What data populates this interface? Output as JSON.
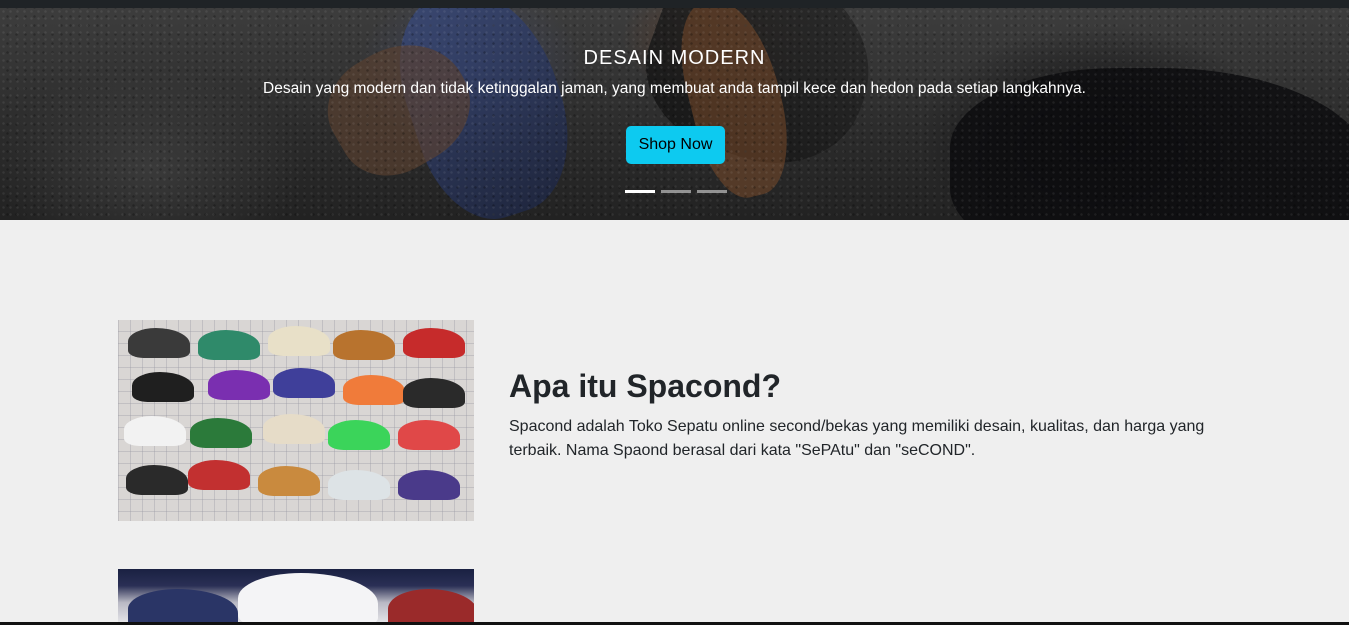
{
  "carousel": {
    "slide": {
      "title": "DESAIN MODERN",
      "text": "Desain yang modern dan tidak ketinggalan jaman, yang membuat anda tampil kece dan hedon pada setiap langkahnya.",
      "button_label": "Shop Now"
    },
    "indicator_count": 3,
    "active_index": 0
  },
  "about": {
    "title": "Apa itu Spacond?",
    "text": "Spacond adalah Toko Sepatu online second/bekas yang memiliki desain, kualitas, dan harga yang terbaik. Nama Spaond berasal dari kata \"SePAtu\" dan \"seCOND\"."
  },
  "colors": {
    "accent": "#0dcaf0",
    "page_bg": "#efefef",
    "text": "#212529"
  }
}
